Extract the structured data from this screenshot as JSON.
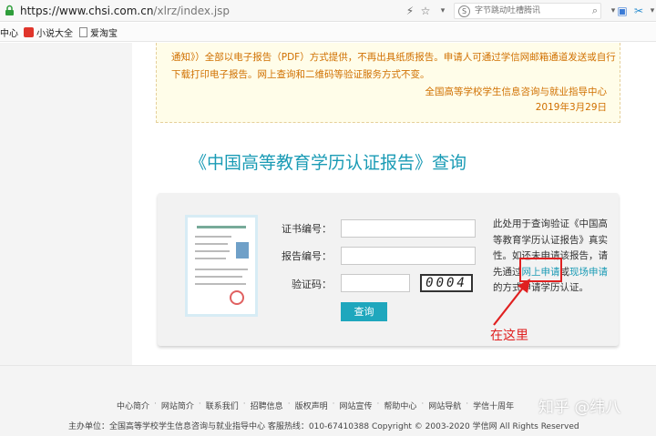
{
  "browser": {
    "url_host": "https://www.chsi.com.cn",
    "url_path": "/xlrz/index.jsp",
    "search_placeholder": "字节跳动吐槽腾讯",
    "bookmarks": [
      "中心",
      "小说大全",
      "爱淘宝"
    ]
  },
  "notice": {
    "line1": "通知》）全部以电子报告（PDF）方式提供，不再出具纸质报告。申请人可通过学信网邮箱通道发送或自行",
    "line2": "下载打印电子报告。网上查询和二维码等验证服务方式不变。",
    "org": "全国高等学校学生信息咨询与就业指导中心",
    "date": "2019年3月29日"
  },
  "page_title": "《中国高等教育学历认证报告》查询",
  "form": {
    "cert_label": "证书编号：",
    "report_label": "报告编号：",
    "captcha_label": "验证码：",
    "captcha_text": "0004",
    "submit_label": "查询"
  },
  "help": {
    "text1": "此处用于查询验证《中国高等教育学历认证报告》真实性。如还未申请该报告，请先通过",
    "link_online": "网上申请",
    "or": "或",
    "link_onsite": "现场申请",
    "text2": "的方式申请学历认证。"
  },
  "annotation": {
    "here": "在这里"
  },
  "footer": {
    "links": [
      "中心简介",
      "网站简介",
      "联系我们",
      "招聘信息",
      "版权声明",
      "网站宣传",
      "帮助中心",
      "网站导航",
      "学信十周年"
    ],
    "info": "主办单位：全国高等学校学生信息咨询与就业指导中心   客服热线：010-67410388   Copyright © 2003-2020 学信网 All Rights Reserved",
    "watermark": "知乎 @纬八"
  },
  "colors": {
    "accent": "#1fa7bd",
    "notice_text": "#d07000",
    "annotation": "#e02020"
  }
}
